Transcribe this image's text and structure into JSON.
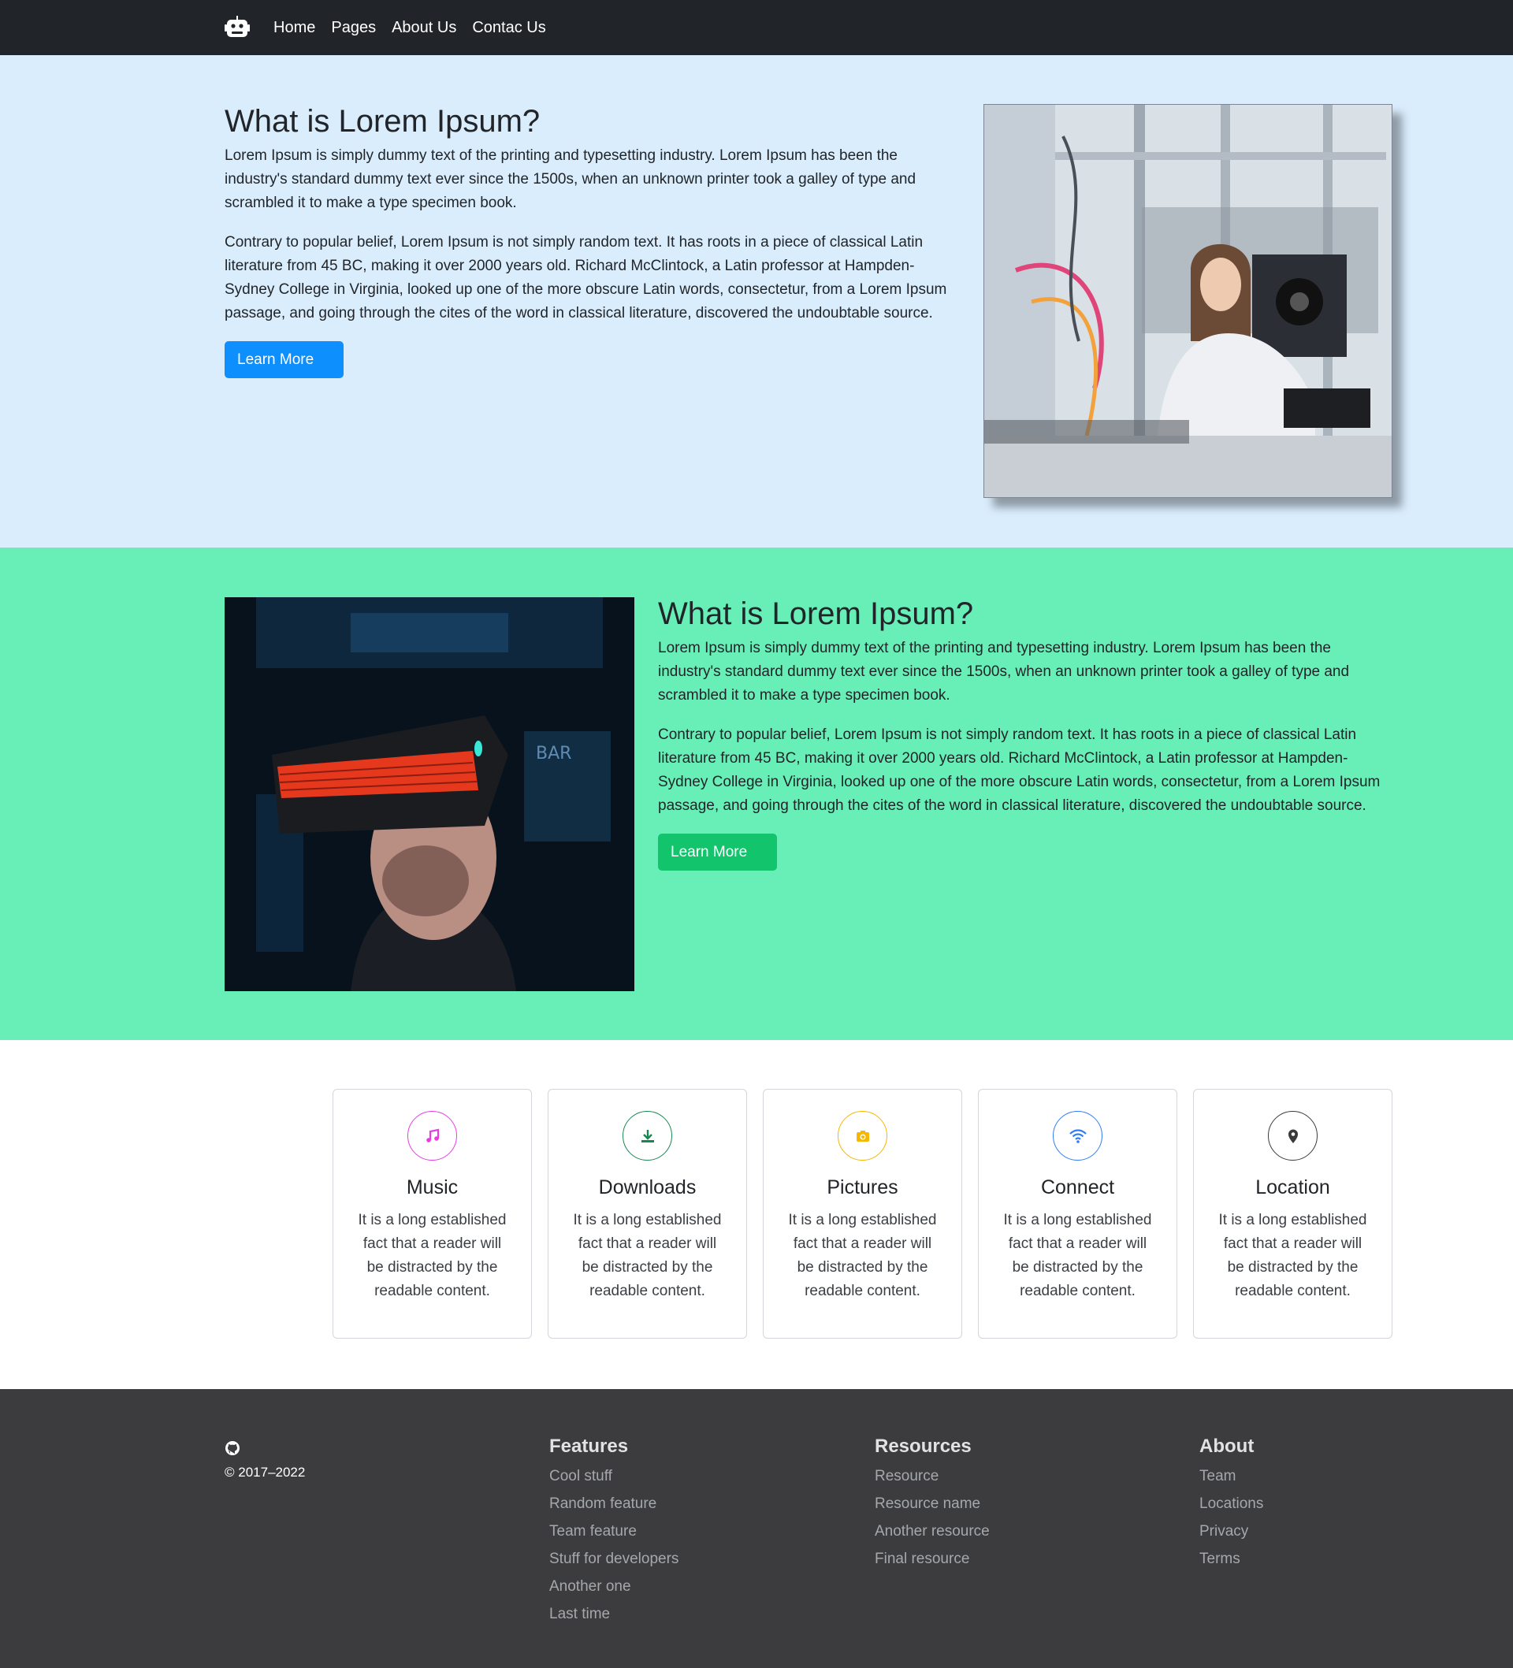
{
  "nav": {
    "links": [
      "Home",
      "Pages",
      "About Us",
      "Contac Us"
    ]
  },
  "hero1": {
    "title": "What is Lorem Ipsum?",
    "p1": "Lorem Ipsum is simply dummy text of the printing and typesetting industry. Lorem Ipsum has been the industry's standard dummy text ever since the 1500s, when an unknown printer took a galley of type and scrambled it to make a type specimen book.",
    "p2": "Contrary to popular belief, Lorem Ipsum is not simply random text. It has roots in a piece of classical Latin literature from 45 BC, making it over 2000 years old. Richard McClintock, a Latin professor at Hampden-Sydney College in Virginia, looked up one of the more obscure Latin words, consectetur, from a Lorem Ipsum passage, and going through the cites of the word in classical literature, discovered the undoubtable source.",
    "button": "Learn More",
    "button_color": "#0d8ffd",
    "background": "#daedfd"
  },
  "hero2": {
    "title": "What is Lorem Ipsum?",
    "p1": "Lorem Ipsum is simply dummy text of the printing and typesetting industry. Lorem Ipsum has been the industry's standard dummy text ever since the 1500s, when an unknown printer took a galley of type and scrambled it to make a type specimen book.",
    "p2": "Contrary to popular belief, Lorem Ipsum is not simply random text. It has roots in a piece of classical Latin literature from 45 BC, making it over 2000 years old. Richard McClintock, a Latin professor at Hampden-Sydney College in Virginia, looked up one of the more obscure Latin words, consectetur, from a Lorem Ipsum passage, and going through the cites of the word in classical literature, discovered the undoubtable source.",
    "button": "Learn More",
    "button_color": "#12c46c",
    "background": "#68efb7"
  },
  "features": [
    {
      "title": "Music",
      "icon": "music-icon",
      "color": "#e83ce3",
      "text": "It is a long established fact that a reader will be distracted by the readable content."
    },
    {
      "title": "Downloads",
      "icon": "download-icon",
      "color": "#198754",
      "text": "It is a long established fact that a reader will be distracted by the readable content."
    },
    {
      "title": "Pictures",
      "icon": "camera-icon",
      "color": "#f5b700",
      "text": "It is a long established fact that a reader will be distracted by the readable content."
    },
    {
      "title": "Connect",
      "icon": "wifi-icon",
      "color": "#2f7df6",
      "text": "It is a long established fact that a reader will be distracted by the readable content."
    },
    {
      "title": "Location",
      "icon": "map-pin-icon",
      "color": "#3a3a3a",
      "text": "It is a long established fact that a reader will be distracted by the readable content."
    }
  ],
  "footer": {
    "copyright": "© 2017–2022",
    "columns": [
      {
        "title": "Features",
        "links": [
          "Cool stuff",
          "Random feature",
          "Team feature",
          "Stuff for developers",
          "Another one",
          "Last time"
        ]
      },
      {
        "title": "Resources",
        "links": [
          "Resource",
          "Resource name",
          "Another resource",
          "Final resource"
        ]
      },
      {
        "title": "About",
        "links": [
          "Team",
          "Locations",
          "Privacy",
          "Terms"
        ]
      }
    ]
  }
}
